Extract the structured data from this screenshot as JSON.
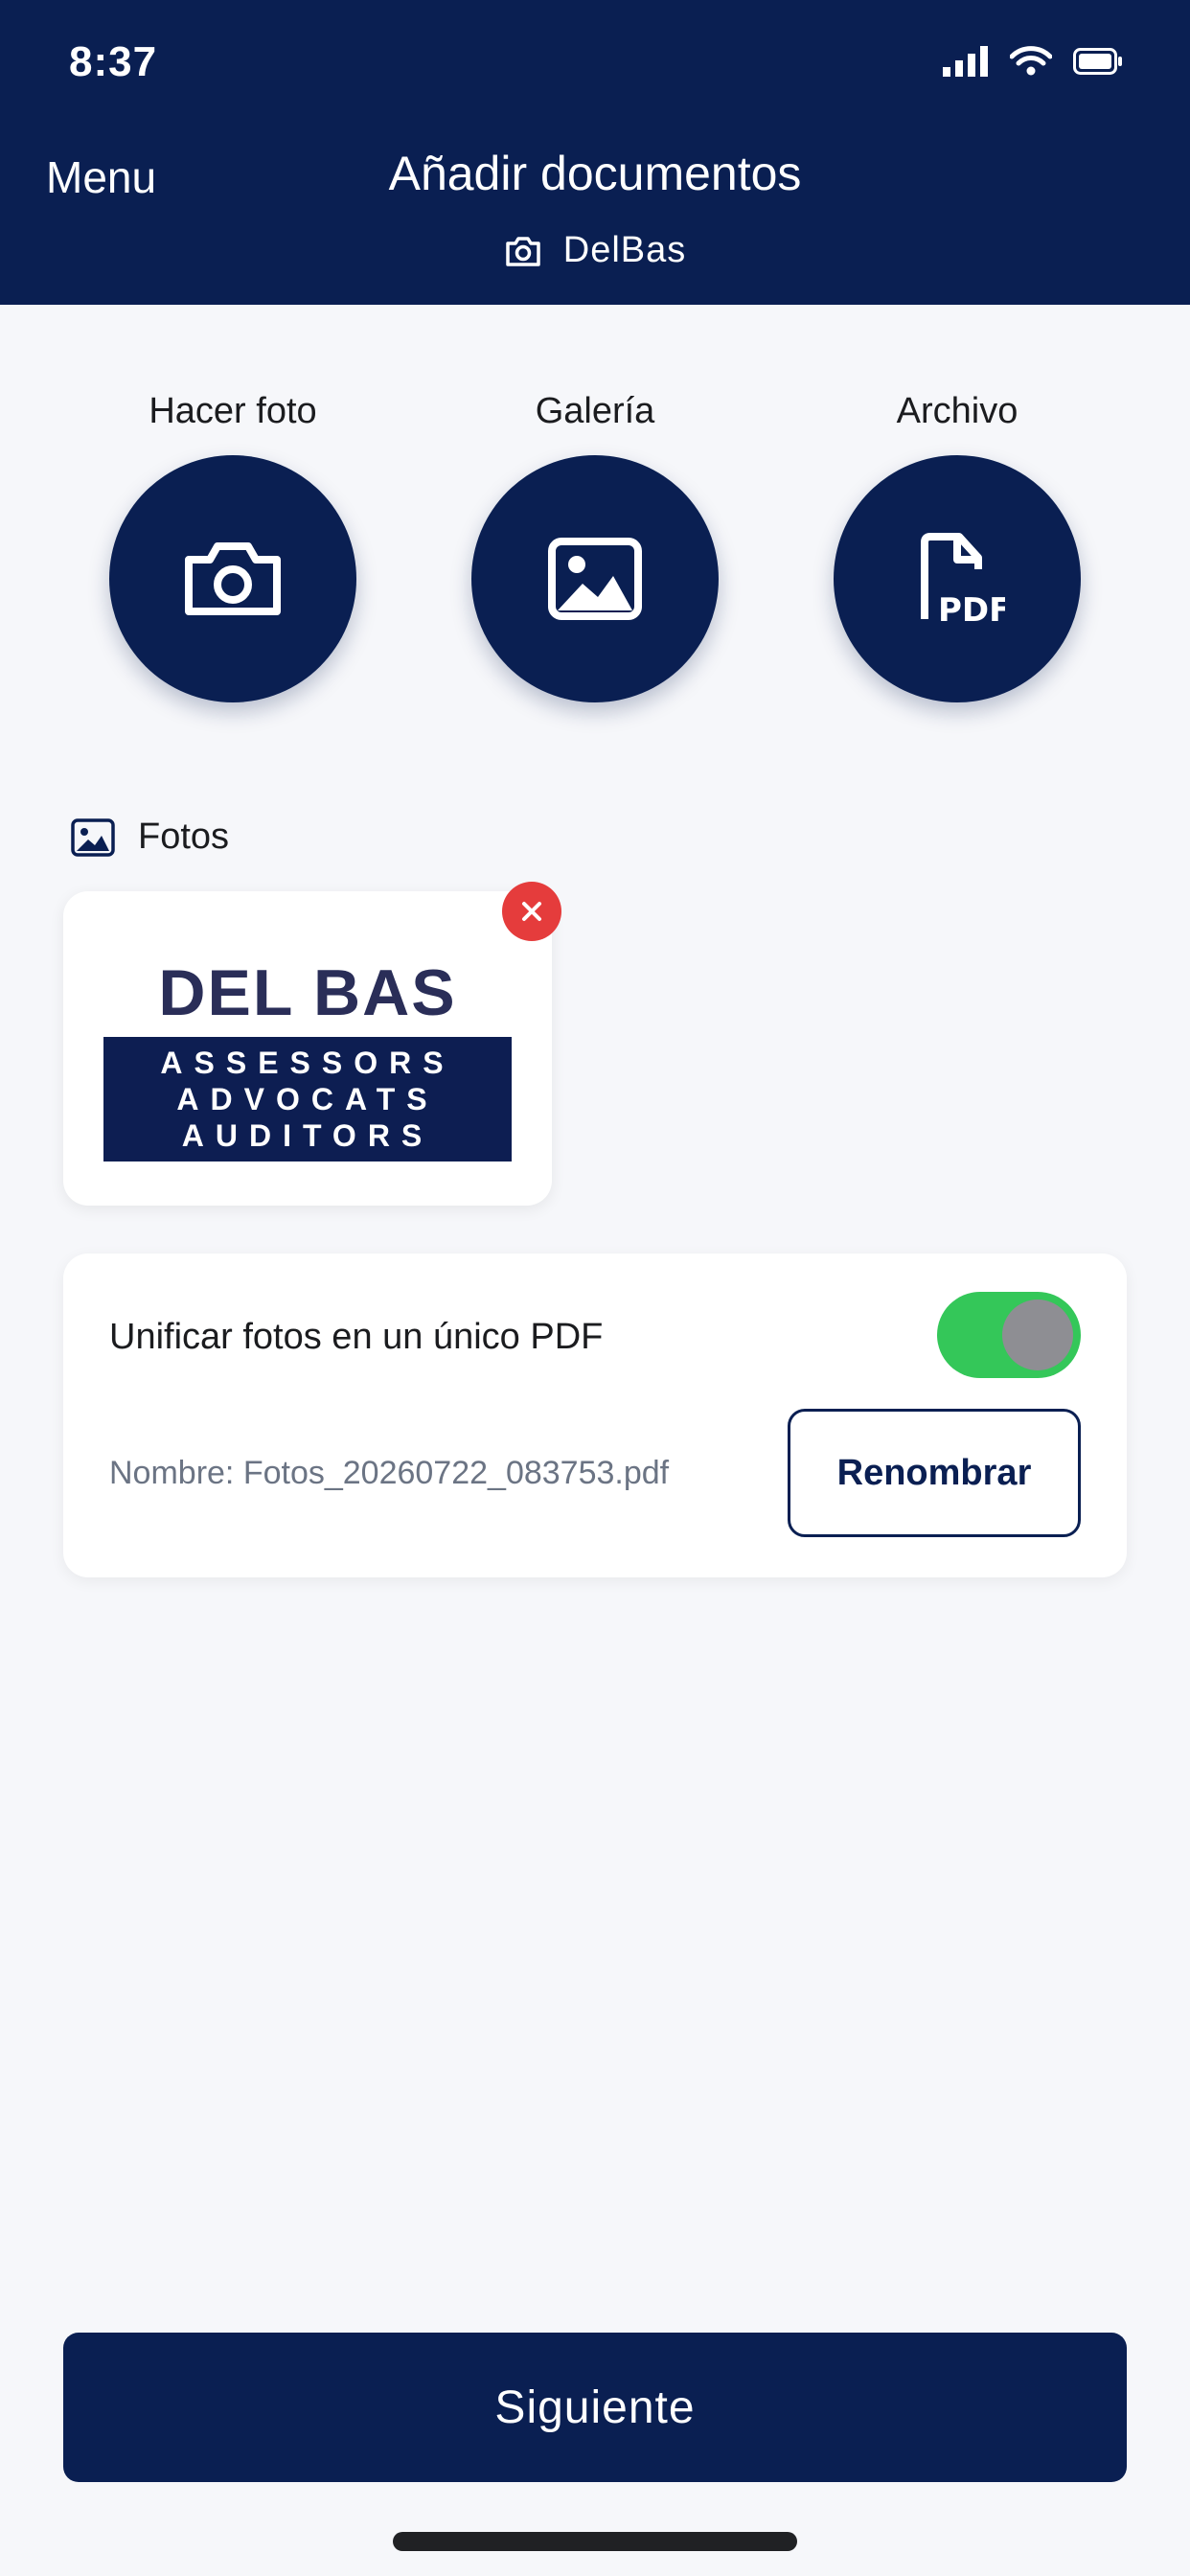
{
  "status_bar": {
    "time": "8:37"
  },
  "header": {
    "menu_label": "Menu",
    "title": "Añadir documentos",
    "subtitle": "DelBas"
  },
  "actions": [
    {
      "label": "Hacer foto",
      "icon": "camera-icon"
    },
    {
      "label": "Galería",
      "icon": "image-icon"
    },
    {
      "label": "Archivo",
      "icon": "pdf-file-icon"
    }
  ],
  "photos": {
    "section_label": "Fotos",
    "items": [
      {
        "logo_title": "DEL BAS",
        "logo_lines": [
          "ASSESSORS",
          "ADVOCATS",
          "AUDITORS"
        ]
      }
    ]
  },
  "merge": {
    "label": "Unificar fotos en un único PDF",
    "enabled": true,
    "filename": "Nombre: Fotos_20260722_083753.pdf",
    "rename_label": "Renombrar"
  },
  "footer": {
    "next_label": "Siguiente"
  },
  "colors": {
    "primary": "#0a1f52",
    "toggle_on": "#34c759",
    "remove": "#e53c3c"
  }
}
